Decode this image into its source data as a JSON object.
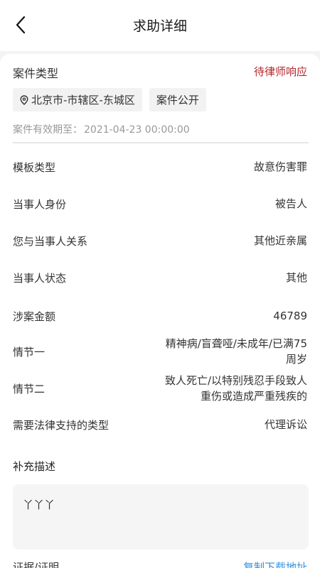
{
  "nav": {
    "title": "求助详细"
  },
  "case": {
    "type_label": "案件类型",
    "status": "待律师响应",
    "tags": {
      "location": "北京市-市辖区-东城区",
      "visibility": "案件公开"
    },
    "validity_label": "案件有效期至：",
    "validity_date": "2021-04-23 00:00:00"
  },
  "details": [
    {
      "label": "模板类型",
      "value": "故意伤害罪"
    },
    {
      "label": "当事人身份",
      "value": "被告人"
    },
    {
      "label": "您与当事人关系",
      "value": "其他近亲属"
    },
    {
      "label": "当事人状态",
      "value": "其他"
    },
    {
      "label": "涉案金额",
      "value": "46789"
    },
    {
      "label": "情节一",
      "value": "精神病/盲聋哑/未成年/已满75周岁"
    },
    {
      "label": "情节二",
      "value": "致人死亡/以特别残忍手段致人重伤或造成严重残疾的"
    },
    {
      "label": "需要法律支持的类型",
      "value": "代理诉讼"
    }
  ],
  "supplement": {
    "title": "补充描述",
    "content": "丫丫丫"
  },
  "evidence": {
    "label": "证据/证明",
    "link": "复制下载地址"
  },
  "colors": {
    "status": "#b3262b",
    "link": "#2f8fe0"
  }
}
